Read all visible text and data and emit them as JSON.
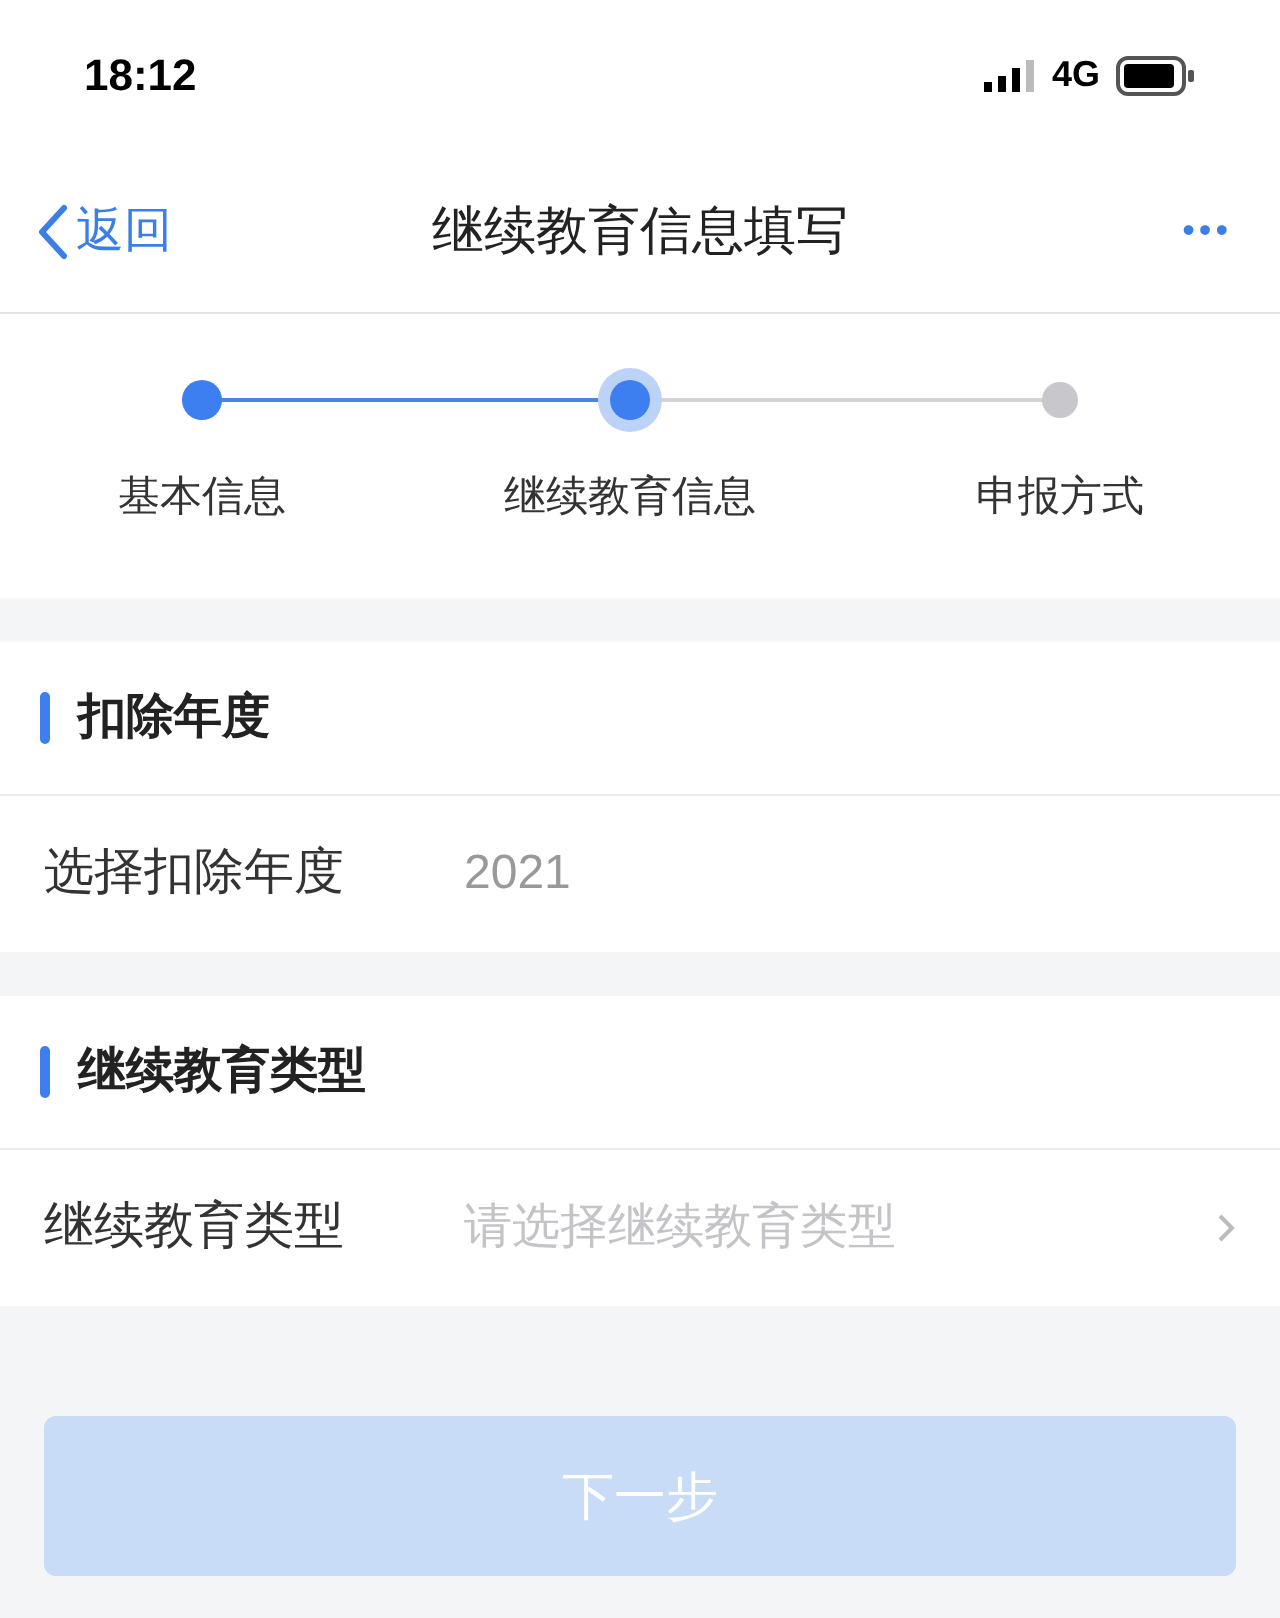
{
  "status_bar": {
    "time": "18:12",
    "network": "4G"
  },
  "nav": {
    "back_label": "返回",
    "title": "继续教育信息填写",
    "more": "•••"
  },
  "steps": [
    {
      "label": "基本信息",
      "completed": true,
      "selected": false
    },
    {
      "label": "继续教育信息",
      "completed": false,
      "selected": true
    },
    {
      "label": "申报方式",
      "completed": false,
      "selected": false
    }
  ],
  "sections": [
    {
      "title": "扣除年度",
      "row": {
        "label": "选择扣除年度",
        "value": "2021",
        "chevron": false
      }
    },
    {
      "title": "继续教育类型",
      "row": {
        "label": "继续教育类型",
        "placeholder": "请选择继续教育类型",
        "chevron": true
      }
    }
  ],
  "next_button": {
    "label": "下一步",
    "disabled": true
  }
}
